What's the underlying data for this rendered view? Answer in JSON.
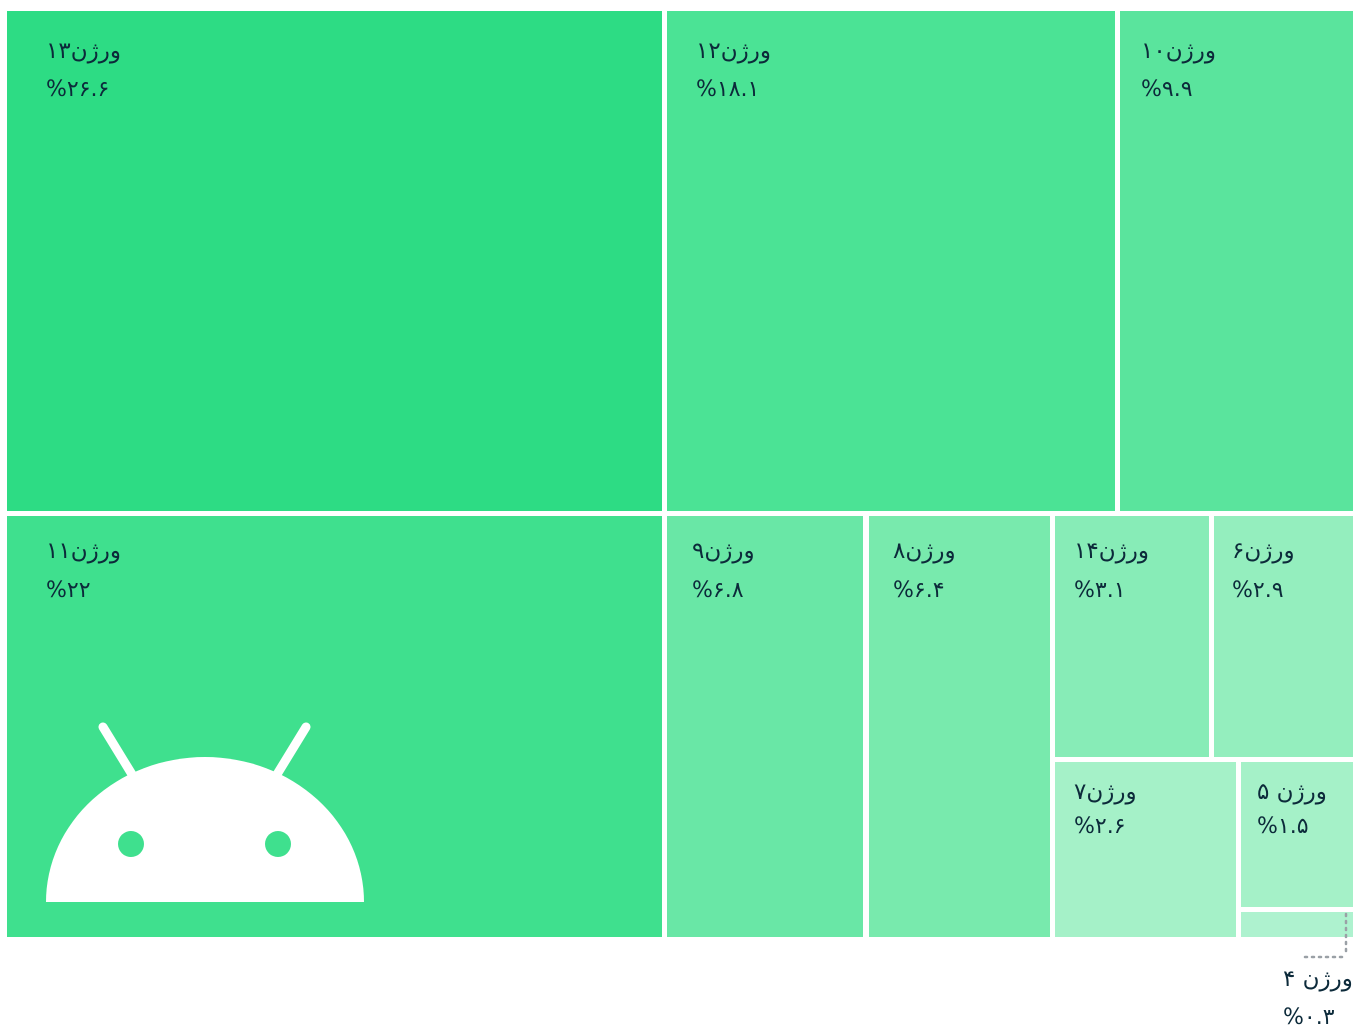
{
  "chart_data": {
    "type": "treemap",
    "title": "",
    "items": [
      {
        "label": "ورژن۱۳",
        "value": 26.6,
        "display": "%۲۶.۶",
        "color": "#2ddc84"
      },
      {
        "label": "ورژن۱۲",
        "value": 18.1,
        "display": "%۱۸.۱",
        "color": "#4be395"
      },
      {
        "label": "ورژن۱۰",
        "value": 9.9,
        "display": "%۹.۹",
        "color": "#5ae49d"
      },
      {
        "label": "ورژن۱۱",
        "value": 22,
        "display": "%۲۲",
        "color": "#3fe08e"
      },
      {
        "label": "ورژن۹",
        "value": 6.8,
        "display": "%۶.۸",
        "color": "#69e7a6"
      },
      {
        "label": "ورژن۸",
        "value": 6.4,
        "display": "%۶.۴",
        "color": "#78eaad"
      },
      {
        "label": "ورژن۱۴",
        "value": 3.1,
        "display": "%۳.۱",
        "color": "#87ecb7"
      },
      {
        "label": "ورژن۶",
        "value": 2.9,
        "display": "%۲.۹",
        "color": "#94eebe"
      },
      {
        "label": "ورژن۷",
        "value": 2.6,
        "display": "%۲.۶",
        "color": "#a5f1c8"
      },
      {
        "label": "ورژن ۵",
        "value": 1.5,
        "display": "%۱.۵",
        "color": "#a5f1c8"
      },
      {
        "label": "ورژن ۴",
        "value": 0.3,
        "display": "%۰.۳",
        "color": "#aef2cf"
      }
    ],
    "legend": "none"
  },
  "colors": {
    "background": "#ffffff",
    "label_text": "#0c2a3a",
    "android_logo": "#ffffff",
    "callout_dots": "#9aa0a6"
  },
  "icons": {
    "android_logo": "android-robot-icon"
  }
}
